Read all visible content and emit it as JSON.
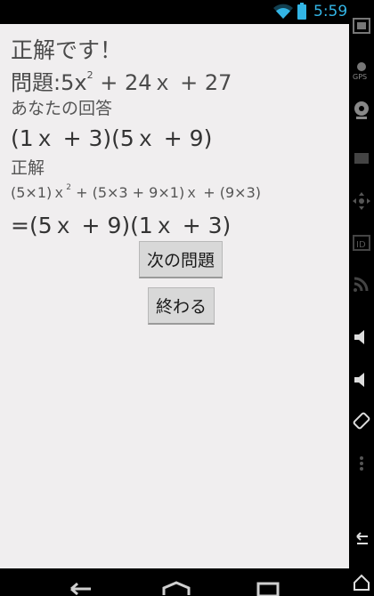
{
  "status_bar": {
    "time": "5:59",
    "wifi_icon": "wifi-icon",
    "battery_icon": "battery-icon"
  },
  "quiz": {
    "result": "正解です！",
    "problem": {
      "prefix": "問題:",
      "coef_a": "5",
      "x": "x",
      "exp": "2",
      "rest": "+ 24ｘ + 27"
    },
    "your_answer_label": "あなたの回答",
    "your_answer": "(1ｘ + 3)(5ｘ + 9)",
    "correct_label": "正解",
    "expansion": {
      "part1": "(5×1)ｘ",
      "exp": "2",
      "part2": "+ (5×3 + 9×1)ｘ + (9×3)"
    },
    "factored": "=(5ｘ + 9)(1ｘ + 3)"
  },
  "buttons": {
    "next": "次の問題",
    "end": "終わる"
  },
  "sidebar_icons": [
    "signal-icon",
    "gps-icon",
    "webcam-icon",
    "camera-icon",
    "move-icon",
    "id-icon",
    "rss-icon",
    "volume-up-icon",
    "volume-down-icon",
    "rotate-icon",
    "dots-icon",
    "back-icon",
    "home-icon",
    "menu-icon"
  ],
  "nav_icons": [
    "back-icon",
    "home-icon",
    "recent-apps-icon"
  ]
}
